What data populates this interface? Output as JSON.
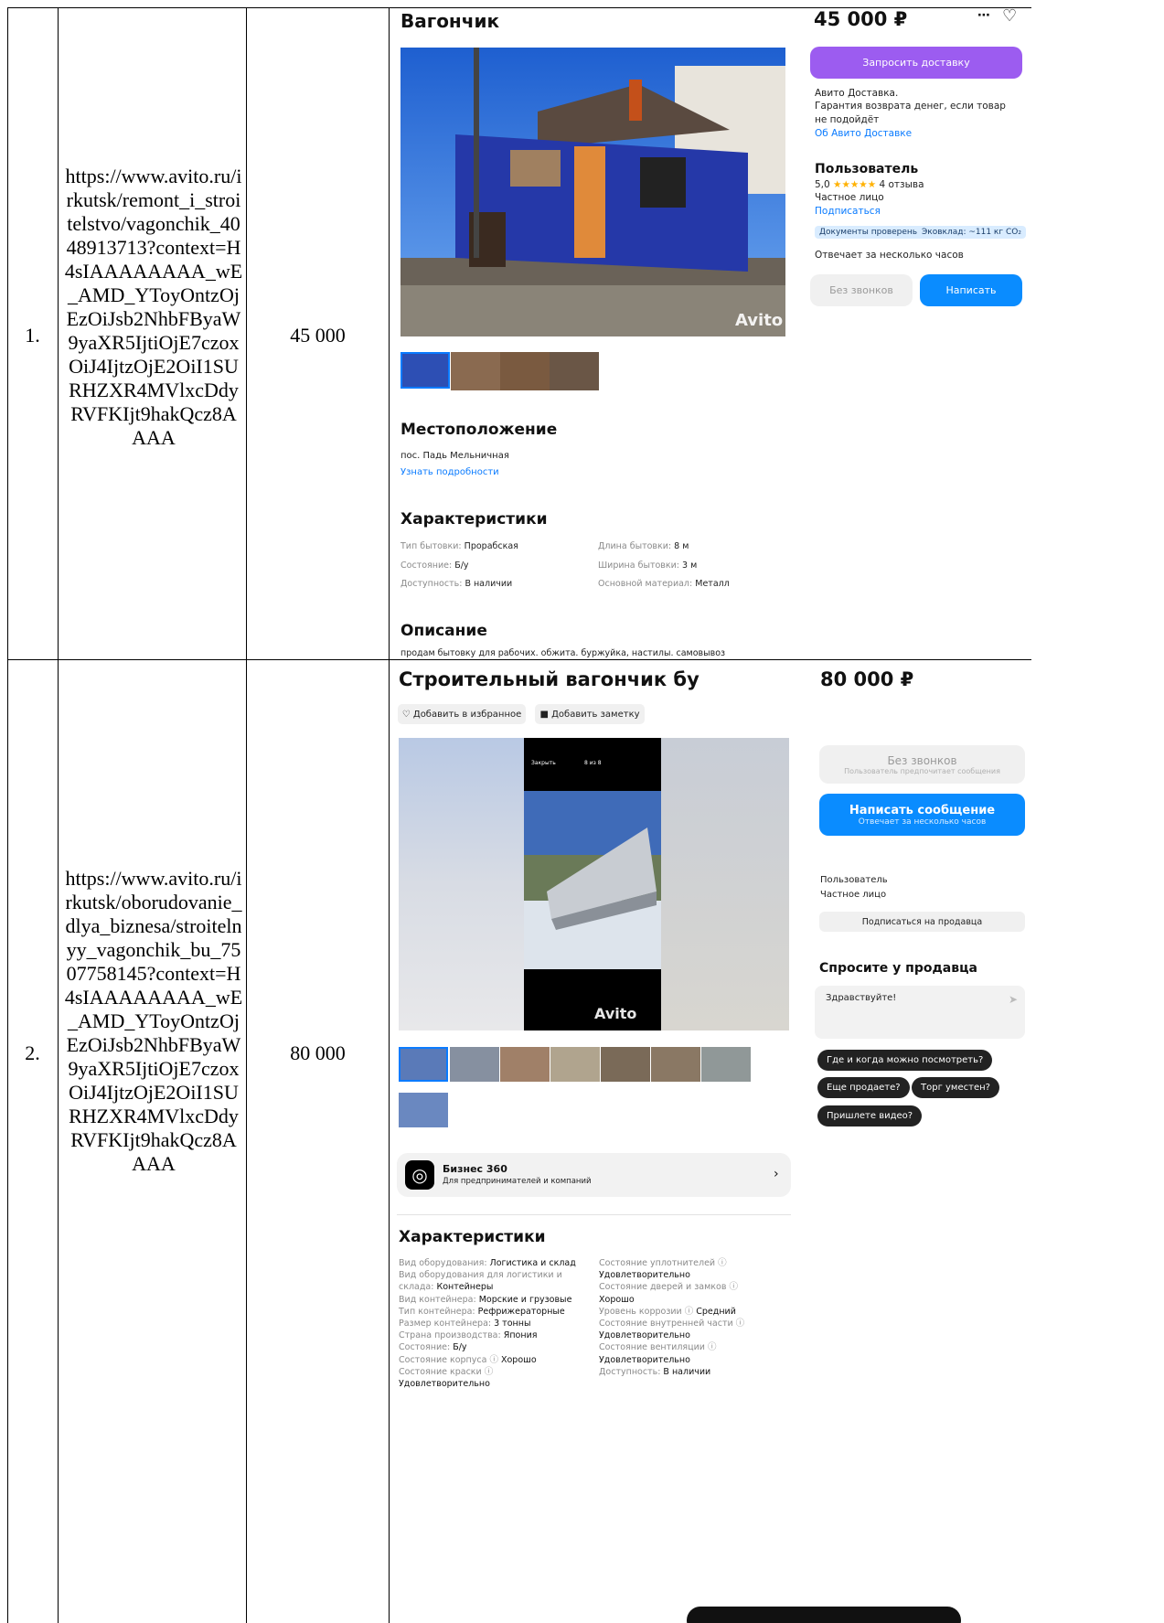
{
  "rows": [
    {
      "num": "1.",
      "url": "https://www.avito.ru/irkutsk/remont_i_stroitelstvo/vagonchik_4048913713?context=H4sIAAAAAAAA_wE_AMD_YToyOntzOjEzOiJsb2NhbFByaW9yaXR5IjtiOjE7czoxOiJ4IjtzOjE2OiI1SURHZXR4MVlxcDdyRVFKIjt9hakQcz8AAAA",
      "price": "45 000",
      "listing": {
        "title": "Вагончик",
        "price": "45 000 ₽",
        "more_icon": "⋯",
        "heart_icon": "♡",
        "watermark": "Avito",
        "delivery_button": "Запросить доставку",
        "delivery_info": [
          "Авито Доставка.",
          "Гарантия возврата денег, если товар",
          "не подойдёт"
        ],
        "delivery_link": "Об Авито Доставке",
        "seller_name": "Пользователь",
        "rating": "5,0",
        "stars": "★★★★★",
        "reviews": "4 отзыва",
        "seller_type": "Частное лицо",
        "subscribe": "Подписаться",
        "badges": [
          "Документы проверены",
          "Эковклад: ~111 кг CO₂"
        ],
        "response_time": "Отвечает за несколько часов",
        "no_calls": "Без звонков",
        "write": "Написать",
        "location_heading": "Местоположение",
        "location": "пос. Падь Мельничная",
        "location_link": "Узнать подробности",
        "specs_heading": "Характеристики",
        "specs_left": [
          {
            "k": "Тип бытовки:",
            "v": "Прорабская"
          },
          {
            "k": "Состояние:",
            "v": "Б/у"
          },
          {
            "k": "Доступность:",
            "v": "В наличии"
          }
        ],
        "specs_right": [
          {
            "k": "Длина бытовки:",
            "v": "8 м"
          },
          {
            "k": "Ширина бытовки:",
            "v": "3 м"
          },
          {
            "k": "Основной материал:",
            "v": "Металл"
          }
        ],
        "desc_heading": "Описание",
        "description": "продам бытовку для рабочих. обжита. буржуйка, настилы. самовывоз"
      }
    },
    {
      "num": "2.",
      "url": "https://www.avito.ru/irkutsk/oborudovanie_dlya_biznesa/stroitelnyy_vagonchik_bu_7507758145?context=H4sIAAAAAAAA_wE_AMD_YToyOntzOjEzOiJsb2NhbFByaW9yaXR5IjtiOjE7czoxOiJ4IjtzOjE2OiI1SURHZXR4MVlxcDdyRVFKIjt9hakQcz8AAAA",
      "price": "80 000",
      "listing": {
        "title": "Строительный вагончик бу",
        "price": "80 000 ₽",
        "fav_button": "Добавить в избранное",
        "note_button": "Добавить заметку",
        "phone_close": "Закрыть",
        "phone_counter": "8 из 8",
        "watermark": "Avito",
        "no_calls": "Без звонков",
        "no_calls_sub": "Пользователь предпочитает сообщения",
        "write_message": "Написать сообщение",
        "write_sub": "Отвечает за несколько часов",
        "seller_name": "Пользователь",
        "seller_type": "Частное лицо",
        "subscribe_seller": "Подписаться на продавца",
        "ask_heading": "Спросите у продавца",
        "ask_placeholder": "Здравствуйте!",
        "quick_questions": [
          "Где и когда можно посмотреть?",
          "Еще продаете?",
          "Торг уместен?",
          "Пришлете видео?"
        ],
        "biz_title": "Бизнес 360",
        "biz_sub": "Для предпринимателей и компаний",
        "specs_heading": "Характеристики",
        "specs_left": [
          {
            "k": "Вид оборудования:",
            "v": "Логистика и склад"
          },
          {
            "k": "Вид оборудования для логистики и",
            "v": ""
          },
          {
            "k": "склада:",
            "v": "Контейнеры"
          },
          {
            "k": "Вид контейнера:",
            "v": "Морские и грузовые"
          },
          {
            "k": "Тип контейнера:",
            "v": "Рефрижераторные"
          },
          {
            "k": "Размер контейнера:",
            "v": "3 тонны"
          },
          {
            "k": "Страна производства:",
            "v": "Япония"
          },
          {
            "k": "Состояние:",
            "v": "Б/у"
          },
          {
            "k": "Состояние корпуса ⓘ",
            "v": "Хорошо"
          },
          {
            "k": "Состояние краски ⓘ",
            "v": ""
          },
          {
            "k": "",
            "v": "Удовлетворительно"
          }
        ],
        "specs_right": [
          {
            "k": "Состояние уплотнителей ⓘ",
            "v": ""
          },
          {
            "k": "",
            "v": "Удовлетворительно"
          },
          {
            "k": "Состояние дверей и замков ⓘ",
            "v": ""
          },
          {
            "k": "",
            "v": "Хорошо"
          },
          {
            "k": "Уровень коррозии ⓘ",
            "v": "Средний"
          },
          {
            "k": "Состояние внутренней части ⓘ",
            "v": ""
          },
          {
            "k": "",
            "v": "Удовлетворительно"
          },
          {
            "k": "Состояние вентиляции ⓘ",
            "v": ""
          },
          {
            "k": "",
            "v": "Удовлетворительно"
          },
          {
            "k": "Доступность:",
            "v": "В наличии"
          }
        ]
      }
    }
  ]
}
